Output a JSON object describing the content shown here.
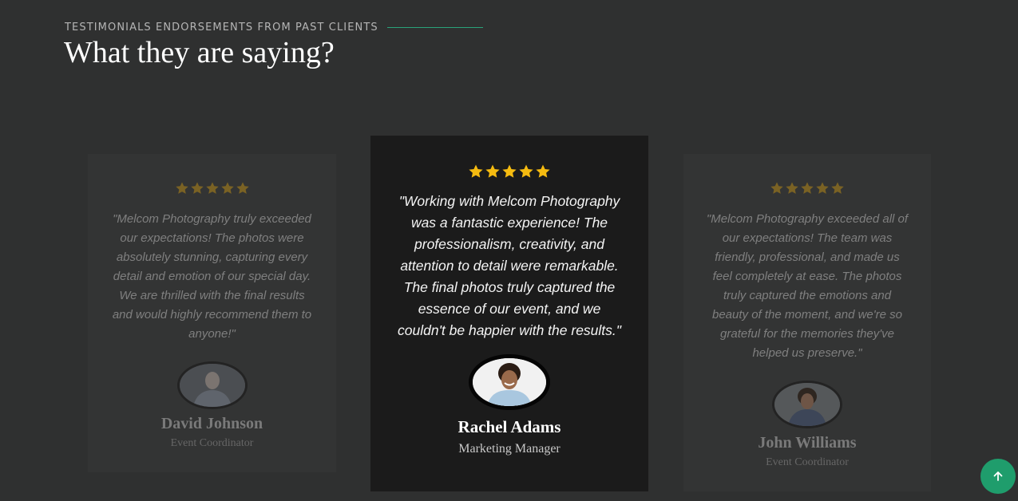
{
  "section": {
    "eyebrow": "TESTIMONIALS ENDORSEMENTS FROM PAST CLIENTS",
    "title": "What they are saying?"
  },
  "testimonials": [
    {
      "rating": 5,
      "quote": "\"Melcom Photography truly exceeded our expectations! The photos were absolutely stunning, capturing every detail and emotion of our special day. We are thrilled with the final results and would highly recommend them to anyone!\"",
      "name": "David Johnson",
      "role": "Event Coordinator",
      "avatar_icon": "person-photo-icon"
    },
    {
      "rating": 5,
      "quote": "\"Working with Melcom Photography was a fantastic experience! The professionalism, creativity, and attention to detail were remarkable. The final photos truly captured the essence of our event, and we couldn't be happier with the results.\"",
      "name": "Rachel Adams",
      "role": "Marketing Manager",
      "avatar_icon": "person-photo-icon"
    },
    {
      "rating": 5,
      "quote": "\"Melcom Photography exceeded all of our expectations! The team was friendly, professional, and made us feel completely at ease. The photos truly captured the emotions and beauty of the moment, and we're so grateful for the memories they've helped us preserve.\"",
      "name": "John Williams",
      "role": "Event Coordinator",
      "avatar_icon": "person-photo-icon"
    }
  ],
  "colors": {
    "background": "#2f3030",
    "accent_line": "#2aa37a",
    "star_active": "#f5bb10",
    "star_dim": "#7a6224",
    "scroll_top_button": "#1f9d6c"
  },
  "scroll_top": {
    "icon": "arrow-up-icon"
  }
}
